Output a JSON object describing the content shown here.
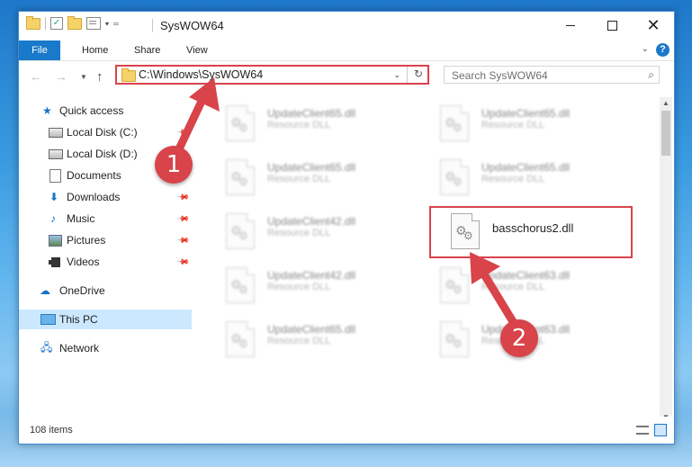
{
  "window": {
    "title": "SysWOW64",
    "controls": {
      "minimize": "",
      "maximize": "",
      "close": "✕"
    }
  },
  "ribbon": {
    "tabs": [
      "File",
      "Home",
      "Share",
      "View"
    ],
    "help": "?"
  },
  "address": {
    "path": "C:\\Windows\\SysWOW64",
    "refresh_icon": "↻"
  },
  "search": {
    "placeholder": "Search SysWOW64"
  },
  "sidebar": {
    "items": [
      {
        "label": "Quick access",
        "icon": "star-icon",
        "pinned": false
      },
      {
        "label": "Local Disk (C:)",
        "icon": "drive-icon",
        "pinned": true
      },
      {
        "label": "Local Disk (D:)",
        "icon": "drive-icon",
        "pinned": false
      },
      {
        "label": "Documents",
        "icon": "documents-icon",
        "pinned": false
      },
      {
        "label": "Downloads",
        "icon": "downloads-icon",
        "pinned": true
      },
      {
        "label": "Music",
        "icon": "music-icon",
        "pinned": true
      },
      {
        "label": "Pictures",
        "icon": "pictures-icon",
        "pinned": true
      },
      {
        "label": "Videos",
        "icon": "videos-icon",
        "pinned": true
      },
      {
        "label": "OneDrive",
        "icon": "onedrive-icon",
        "pinned": false
      },
      {
        "label": "This PC",
        "icon": "this-pc-icon",
        "pinned": false,
        "selected": true
      },
      {
        "label": "Network",
        "icon": "network-icon",
        "pinned": false
      }
    ]
  },
  "files": [
    {
      "name": "UpdateClient65.dll",
      "type": "Resource DLL",
      "faded": true
    },
    {
      "name": "UpdateClient65.dll",
      "type": "Resource DLL",
      "faded": true
    },
    {
      "name": "UpdateClient65.dll",
      "type": "Resource DLL",
      "faded": true
    },
    {
      "name": "UpdateClient65.dll",
      "type": "Resource DLL",
      "faded": true
    },
    {
      "name": "UpdateClient42.dll",
      "type": "Resource DLL",
      "faded": true
    },
    {
      "name": "basschorus2.dll",
      "type": "",
      "faded": false
    },
    {
      "name": "UpdateClient42.dll",
      "type": "Resource DLL",
      "faded": true
    },
    {
      "name": "UpdateClient63.dll",
      "type": "Resource DLL",
      "faded": true
    },
    {
      "name": "UpdateClient65.dll",
      "type": "Resource DLL",
      "faded": true
    },
    {
      "name": "UpdateClient63.dll",
      "type": "Resource DLL",
      "faded": true
    }
  ],
  "status": {
    "item_count": "108 items"
  },
  "annotations": {
    "step1": "1",
    "step2": "2",
    "color": "#d9434a"
  }
}
